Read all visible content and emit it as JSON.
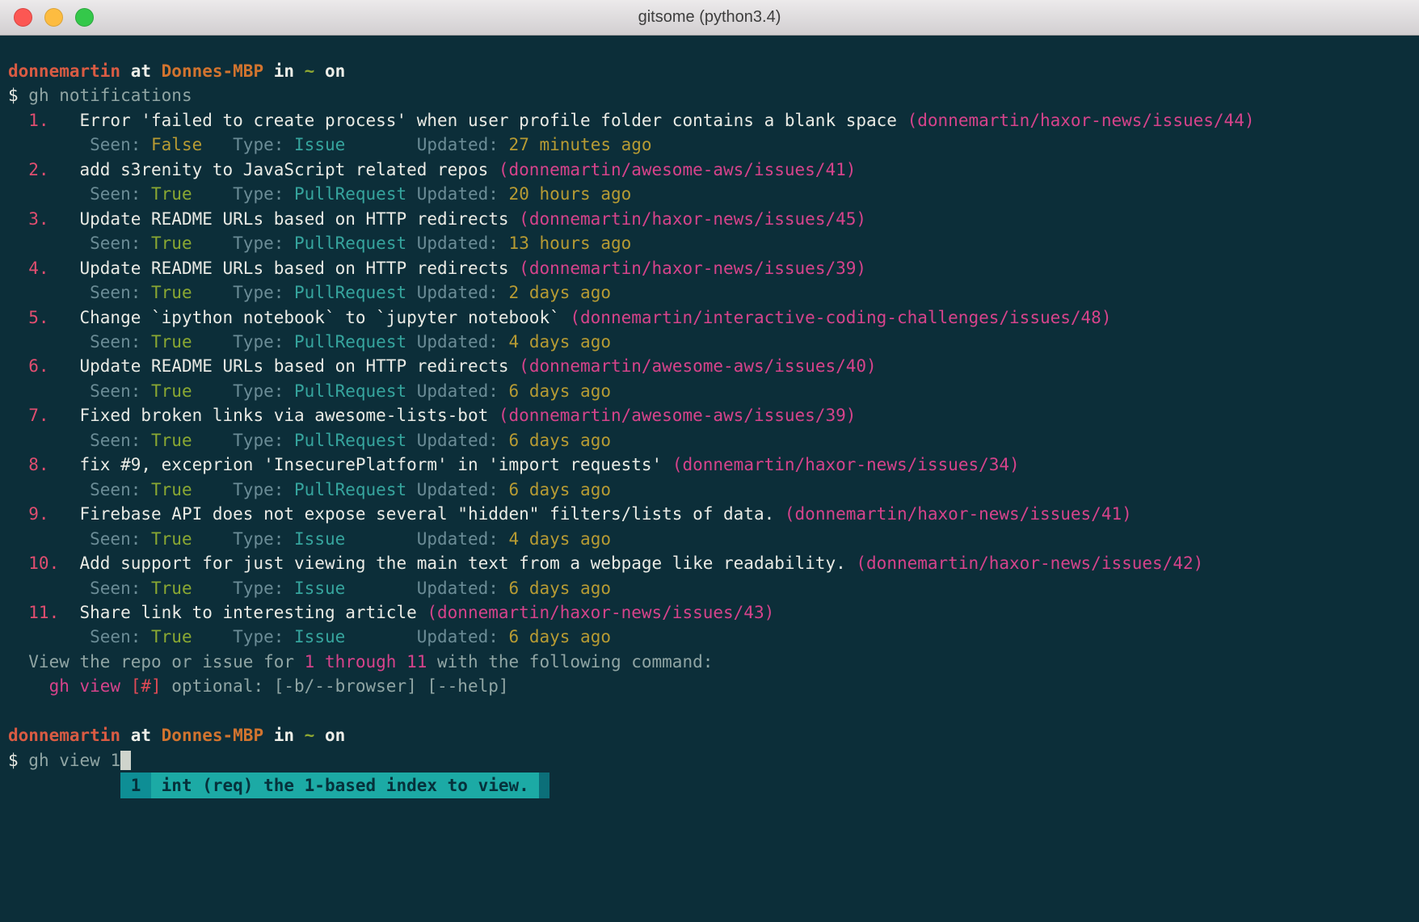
{
  "window": {
    "title": "gitsome (python3.4)"
  },
  "terminal": {
    "lines": [
      [
        [
          "user",
          "donnemartin"
        ],
        [
          "boldw",
          " at "
        ],
        [
          "host",
          "Donnes-MBP"
        ],
        [
          "boldw",
          " in "
        ],
        [
          "tilde",
          "~"
        ],
        [
          "boldw",
          " on"
        ]
      ],
      [
        [
          "white",
          "$"
        ],
        [
          "cmd",
          " gh notifications"
        ]
      ],
      [
        [
          "num",
          "  1."
        ],
        [
          "title",
          "   Error 'failed to create process' when user profile folder contains a blank space "
        ],
        [
          "link",
          "(donnemartin/haxor-news/issues/44)"
        ]
      ],
      [
        [
          "label",
          "        Seen: "
        ],
        [
          "false",
          "False"
        ],
        [
          "label",
          "   Type: "
        ],
        [
          "type",
          "Issue"
        ],
        [
          "label",
          "       Updated: "
        ],
        [
          "time",
          "27 minutes ago"
        ]
      ],
      [
        [
          "num",
          "  2."
        ],
        [
          "title",
          "   add s3renity to JavaScript related repos "
        ],
        [
          "link",
          "(donnemartin/awesome-aws/issues/41)"
        ]
      ],
      [
        [
          "label",
          "        Seen: "
        ],
        [
          "true",
          "True"
        ],
        [
          "label",
          "    Type: "
        ],
        [
          "type",
          "PullRequest"
        ],
        [
          "label",
          " Updated: "
        ],
        [
          "time",
          "20 hours ago"
        ]
      ],
      [
        [
          "num",
          "  3."
        ],
        [
          "title",
          "   Update README URLs based on HTTP redirects "
        ],
        [
          "link",
          "(donnemartin/haxor-news/issues/45)"
        ]
      ],
      [
        [
          "label",
          "        Seen: "
        ],
        [
          "true",
          "True"
        ],
        [
          "label",
          "    Type: "
        ],
        [
          "type",
          "PullRequest"
        ],
        [
          "label",
          " Updated: "
        ],
        [
          "time",
          "13 hours ago"
        ]
      ],
      [
        [
          "num",
          "  4."
        ],
        [
          "title",
          "   Update README URLs based on HTTP redirects "
        ],
        [
          "link",
          "(donnemartin/haxor-news/issues/39)"
        ]
      ],
      [
        [
          "label",
          "        Seen: "
        ],
        [
          "true",
          "True"
        ],
        [
          "label",
          "    Type: "
        ],
        [
          "type",
          "PullRequest"
        ],
        [
          "label",
          " Updated: "
        ],
        [
          "time",
          "2 days ago"
        ]
      ],
      [
        [
          "num",
          "  5."
        ],
        [
          "title",
          "   Change `ipython notebook` to `jupyter notebook` "
        ],
        [
          "link",
          "(donnemartin/interactive-coding-challenges/issues/48)"
        ]
      ],
      [
        [
          "label",
          "        Seen: "
        ],
        [
          "true",
          "True"
        ],
        [
          "label",
          "    Type: "
        ],
        [
          "type",
          "PullRequest"
        ],
        [
          "label",
          " Updated: "
        ],
        [
          "time",
          "4 days ago"
        ]
      ],
      [
        [
          "num",
          "  6."
        ],
        [
          "title",
          "   Update README URLs based on HTTP redirects "
        ],
        [
          "link",
          "(donnemartin/awesome-aws/issues/40)"
        ]
      ],
      [
        [
          "label",
          "        Seen: "
        ],
        [
          "true",
          "True"
        ],
        [
          "label",
          "    Type: "
        ],
        [
          "type",
          "PullRequest"
        ],
        [
          "label",
          " Updated: "
        ],
        [
          "time",
          "6 days ago"
        ]
      ],
      [
        [
          "num",
          "  7."
        ],
        [
          "title",
          "   Fixed broken links via awesome-lists-bot "
        ],
        [
          "link",
          "(donnemartin/awesome-aws/issues/39)"
        ]
      ],
      [
        [
          "label",
          "        Seen: "
        ],
        [
          "true",
          "True"
        ],
        [
          "label",
          "    Type: "
        ],
        [
          "type",
          "PullRequest"
        ],
        [
          "label",
          " Updated: "
        ],
        [
          "time",
          "6 days ago"
        ]
      ],
      [
        [
          "num",
          "  8."
        ],
        [
          "title",
          "   fix #9, exceprion 'InsecurePlatform' in 'import requests' "
        ],
        [
          "link",
          "(donnemartin/haxor-news/issues/34)"
        ]
      ],
      [
        [
          "label",
          "        Seen: "
        ],
        [
          "true",
          "True"
        ],
        [
          "label",
          "    Type: "
        ],
        [
          "type",
          "PullRequest"
        ],
        [
          "label",
          " Updated: "
        ],
        [
          "time",
          "6 days ago"
        ]
      ],
      [
        [
          "num",
          "  9."
        ],
        [
          "title",
          "   Firebase API does not expose several \"hidden\" filters/lists of data. "
        ],
        [
          "link",
          "(donnemartin/haxor-news/issues/41)"
        ]
      ],
      [
        [
          "label",
          "        Seen: "
        ],
        [
          "true",
          "True"
        ],
        [
          "label",
          "    Type: "
        ],
        [
          "type",
          "Issue"
        ],
        [
          "label",
          "       Updated: "
        ],
        [
          "time",
          "4 days ago"
        ]
      ],
      [
        [
          "num",
          "  10."
        ],
        [
          "title",
          "  Add support for just viewing the main text from a webpage like readability. "
        ],
        [
          "link",
          "(donnemartin/haxor-news/issues/42)"
        ]
      ],
      [
        [
          "label",
          "        Seen: "
        ],
        [
          "true",
          "True"
        ],
        [
          "label",
          "    Type: "
        ],
        [
          "type",
          "Issue"
        ],
        [
          "label",
          "       Updated: "
        ],
        [
          "time",
          "6 days ago"
        ]
      ],
      [
        [
          "num",
          "  11."
        ],
        [
          "title",
          "  Share link to interesting article "
        ],
        [
          "link",
          "(donnemartin/haxor-news/issues/43)"
        ]
      ],
      [
        [
          "label",
          "        Seen: "
        ],
        [
          "true",
          "True"
        ],
        [
          "label",
          "    Type: "
        ],
        [
          "type",
          "Issue"
        ],
        [
          "label",
          "       Updated: "
        ],
        [
          "time",
          "6 days ago"
        ]
      ],
      [
        [
          "cmd",
          "  View the repo or issue for "
        ],
        [
          "pink",
          "1 through 11"
        ],
        [
          "cmd",
          " with the following command:"
        ]
      ],
      [
        [
          "pink",
          "    gh view "
        ],
        [
          "red",
          "[#]"
        ],
        [
          "cmd",
          " optional: [-b/--browser] [--help]"
        ]
      ],
      [],
      [
        [
          "user",
          "donnemartin"
        ],
        [
          "boldw",
          " at "
        ],
        [
          "host",
          "Donnes-MBP"
        ],
        [
          "boldw",
          " in "
        ],
        [
          "tilde",
          "~"
        ],
        [
          "boldw",
          " on"
        ]
      ],
      [
        [
          "white",
          "$"
        ],
        [
          "cmd",
          " gh view 1"
        ],
        [
          "cursor",
          " "
        ]
      ],
      [
        [
          "plain",
          "           "
        ],
        [
          "popidx",
          " 1 "
        ],
        [
          "popmeta",
          " int (req) the 1-based index to view. "
        ],
        [
          "popscroll",
          " "
        ]
      ]
    ]
  }
}
